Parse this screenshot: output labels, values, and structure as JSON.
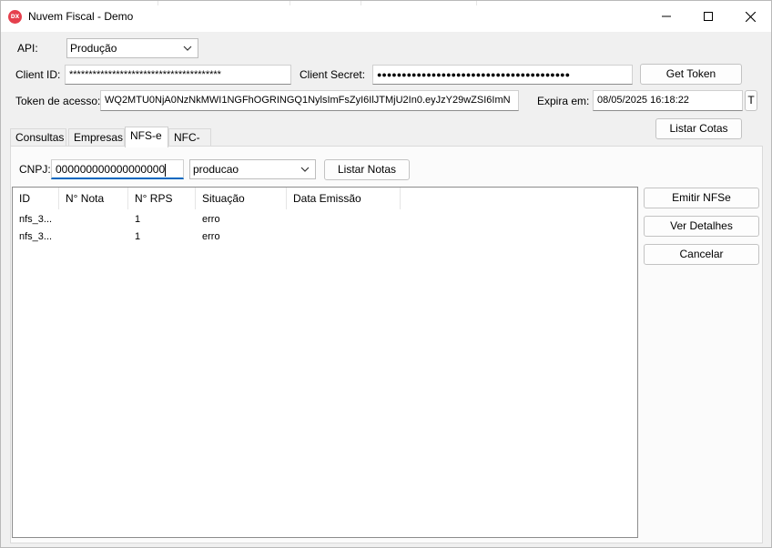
{
  "window": {
    "title": "Nuvem Fiscal - Demo",
    "icon_text": "DX",
    "icon_color": "#e5404d"
  },
  "form": {
    "api_label": "API:",
    "api_value": "Produção",
    "client_id_label": "Client ID:",
    "client_id_value": "***************************************",
    "client_secret_label": "Client Secret:",
    "client_secret_value": "●●●●●●●●●●●●●●●●●●●●●●●●●●●●●●●●●●●●●●●",
    "get_token_label": "Get Token",
    "token_label": "Token de acesso:",
    "token_value": "WQ2MTU0NjA0NzNkMWI1NGFhOGRINGQ1NylsImFsZyI6IlJTMjU2In0.eyJzY29wZSI6ImN",
    "expira_label": "Expira em:",
    "expira_value": "08/05/2025 16:18:22",
    "t_button_label": "T",
    "listar_cotas_label": "Listar Cotas"
  },
  "tabs": [
    {
      "label": "Consultas"
    },
    {
      "label": "Empresas"
    },
    {
      "label": "NFS-e"
    },
    {
      "label": "NFC-e"
    }
  ],
  "active_tab": "NFS-e",
  "nfse": {
    "cnpj_label": "CNPJ:",
    "cnpj_value": "000000000000000000",
    "ambiente_value": "producao",
    "listar_notas_label": "Listar Notas",
    "columns": [
      "ID",
      "N° Nota",
      "N° RPS",
      "Situação",
      "Data Emissão"
    ],
    "rows": [
      {
        "id": "nfs_3...",
        "nota": "",
        "rps": "1",
        "situacao": "erro",
        "data": ""
      },
      {
        "id": "nfs_3...",
        "nota": "",
        "rps": "1",
        "situacao": "erro",
        "data": ""
      }
    ],
    "emitir_label": "Emitir NFSe",
    "ver_detalhes_label": "Ver Detalhes",
    "cancelar_label": "Cancelar"
  },
  "colors": {
    "focus_underline": "#0067c0",
    "window_bg": "#f0f0f0"
  }
}
